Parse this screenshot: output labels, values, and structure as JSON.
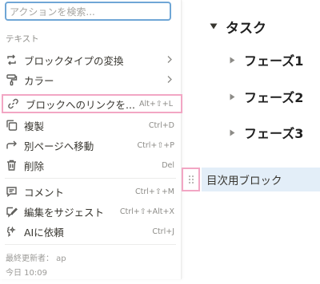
{
  "menu": {
    "search_placeholder": "アクションを検索...",
    "section_label": "テキスト",
    "items": [
      {
        "label": "ブロックタイプの変換",
        "shortcut": "",
        "icon": "convert-icon",
        "submenu": true
      },
      {
        "label": "カラー",
        "shortcut": "",
        "icon": "paint-roller-icon",
        "submenu": true
      },
      {
        "label": "ブロックへのリンクを...",
        "shortcut": "Alt+⇧+L",
        "icon": "link-icon",
        "submenu": false
      },
      {
        "label": "複製",
        "shortcut": "Ctrl+D",
        "icon": "duplicate-icon",
        "submenu": false
      },
      {
        "label": "別ページへ移動",
        "shortcut": "Ctrl+⇧+P",
        "icon": "move-arrow-icon",
        "submenu": false
      },
      {
        "label": "削除",
        "shortcut": "Del",
        "icon": "trash-icon",
        "submenu": false
      },
      {
        "label": "コメント",
        "shortcut": "Ctrl+⇧+M",
        "icon": "comment-icon",
        "submenu": false
      },
      {
        "label": "編集をサジェスト",
        "shortcut": "Ctrl+⇧+Alt+X",
        "icon": "suggest-edit-icon",
        "submenu": false
      },
      {
        "label": "AIに依頼",
        "shortcut": "Ctrl+J",
        "icon": "ai-icon",
        "submenu": false
      }
    ],
    "last_edited_by": "最終更新者： ap",
    "last_edited_time": "今日 10:09"
  },
  "content": {
    "task_heading": "タスク",
    "phases": [
      "フェーズ1",
      "フェーズ2",
      "フェーズ3"
    ],
    "toc_block": "目次用ブロック"
  },
  "colors": {
    "highlight_border": "#f2a6c4",
    "search_border": "#6fa6d6",
    "selected_block_bg": "#e3eef8"
  }
}
